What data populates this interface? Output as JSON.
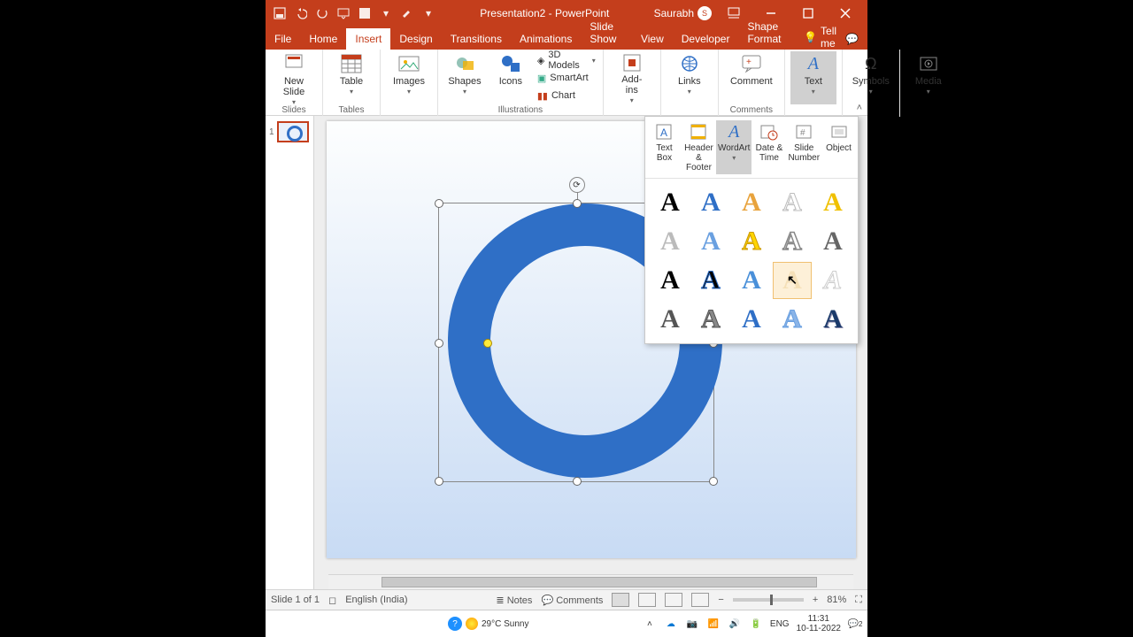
{
  "title": "Presentation2 - PowerPoint",
  "user": "Saurabh",
  "tabs": {
    "file": "File",
    "home": "Home",
    "insert": "Insert",
    "design": "Design",
    "transitions": "Transitions",
    "animations": "Animations",
    "slideshow": "Slide Show",
    "view": "View",
    "developer": "Developer",
    "shapeformat": "Shape Format",
    "tellme": "Tell me"
  },
  "ribbon": {
    "slides": {
      "label": "Slides",
      "new": "New\nSlide"
    },
    "tables": {
      "label": "Tables",
      "table": "Table"
    },
    "images": {
      "label": "",
      "images": "Images"
    },
    "illustrations": {
      "label": "Illustrations",
      "shapes": "Shapes",
      "icons": "Icons",
      "models": "3D Models",
      "smartart": "SmartArt",
      "chart": "Chart"
    },
    "addins": {
      "label": "",
      "addins": "Add-\nins"
    },
    "links": {
      "label": "",
      "links": "Links"
    },
    "comments": {
      "label": "Comments",
      "comment": "Comment"
    },
    "text": {
      "label": "",
      "text": "Text"
    },
    "symbols": {
      "label": "",
      "symbols": "Symbols"
    },
    "media": {
      "label": "",
      "media": "Media"
    }
  },
  "popup": {
    "textbox": "Text\nBox",
    "header": "Header\n& Footer",
    "wordart": "WordArt",
    "datetime": "Date &\nTime",
    "slidenum": "Slide\nNumber",
    "object": "Object"
  },
  "thumb": {
    "num": "1"
  },
  "status": {
    "slide": "Slide 1 of 1",
    "lang": "English (India)",
    "notes": "Notes",
    "comments": "Comments",
    "zoom": "81%"
  },
  "taskbar": {
    "weather": "29°C Sunny",
    "lang": "ENG",
    "time": "11:31",
    "date": "10-11-2022"
  }
}
